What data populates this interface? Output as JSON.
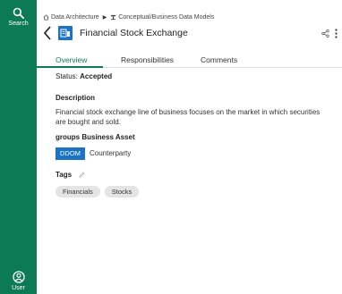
{
  "rail": {
    "search_label": "Search",
    "user_label": "User"
  },
  "breadcrumb": {
    "items": [
      "Data Architecture",
      "Conceptual/Business Data Models"
    ]
  },
  "header": {
    "title": "Financial Stock Exchange"
  },
  "tabs": [
    {
      "label": "Overview",
      "active": true
    },
    {
      "label": "Responsibilities",
      "active": false
    },
    {
      "label": "Comments",
      "active": false
    }
  ],
  "overview": {
    "status_label": "Status:",
    "status_value": "Accepted",
    "description_heading": "Description",
    "description_text": "Financial stock exchange line of business focuses on the market in which securities are bought and sold.",
    "groups_heading": "groups Business Asset",
    "groups_badge": "DDOM",
    "groups_value": "Counterparty",
    "tags_heading": "Tags",
    "tags": [
      "Financials",
      "Stocks"
    ]
  },
  "colors": {
    "rail": "#0c7a54",
    "accent_green": "#0c7a54",
    "accent_blue": "#1a73c4",
    "tag_bg": "#e4e4e4"
  },
  "icons": {
    "search": "search-icon",
    "user": "user-icon",
    "home": "home-icon",
    "model": "model-icon",
    "back": "chevron-left-icon",
    "asset": "asset-type-icon",
    "share": "share-icon",
    "more": "more-vertical-icon",
    "edit": "pencil-icon"
  }
}
